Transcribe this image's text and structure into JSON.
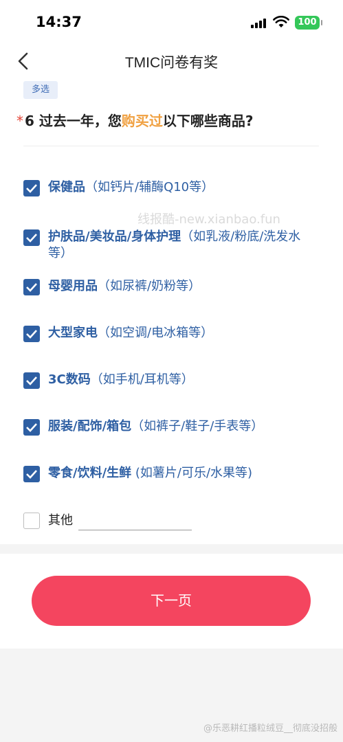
{
  "status_bar": {
    "time": "14:37",
    "battery": "100"
  },
  "header": {
    "title": "TMIC问卷有奖",
    "back_icon": "chevron-left-icon"
  },
  "question": {
    "tag": "多选",
    "required_mark": "*",
    "prefix": "6 过去一年，您",
    "highlight": "购买过",
    "suffix": "以下哪些商品?"
  },
  "options": [
    {
      "main": "保健品",
      "sub": "（如钙片/辅酶Q10等）",
      "checked": true
    },
    {
      "main": "护肤品/美妆品/身体护理",
      "sub": "（如乳液/粉底/洗发水等）",
      "checked": true
    },
    {
      "main": "母婴用品",
      "sub": "（如尿裤/奶粉等）",
      "checked": true
    },
    {
      "main": "大型家电",
      "sub": "（如空调/电冰箱等）",
      "checked": true
    },
    {
      "main": "3C数码",
      "sub": "（如手机/耳机等）",
      "checked": true
    },
    {
      "main": "服装/配饰/箱包",
      "sub": "（如裤子/鞋子/手表等）",
      "checked": true
    },
    {
      "main": "零食/饮料/生鲜",
      "sub": " (如薯片/可乐/水果等)",
      "checked": true
    }
  ],
  "other_option": {
    "label": "其他",
    "value": "",
    "checked": false
  },
  "footer": {
    "next_label": "下一页"
  },
  "watermark": "线报酷-new.xianbao.fun",
  "weibo_watermark": "@乐恶耕红播粒绒豆__彻底没招般",
  "colors": {
    "primary_blue": "#2e5fa3",
    "highlight_orange": "#f0a040",
    "button_red": "#f4455f",
    "required_red": "#e5483a"
  }
}
